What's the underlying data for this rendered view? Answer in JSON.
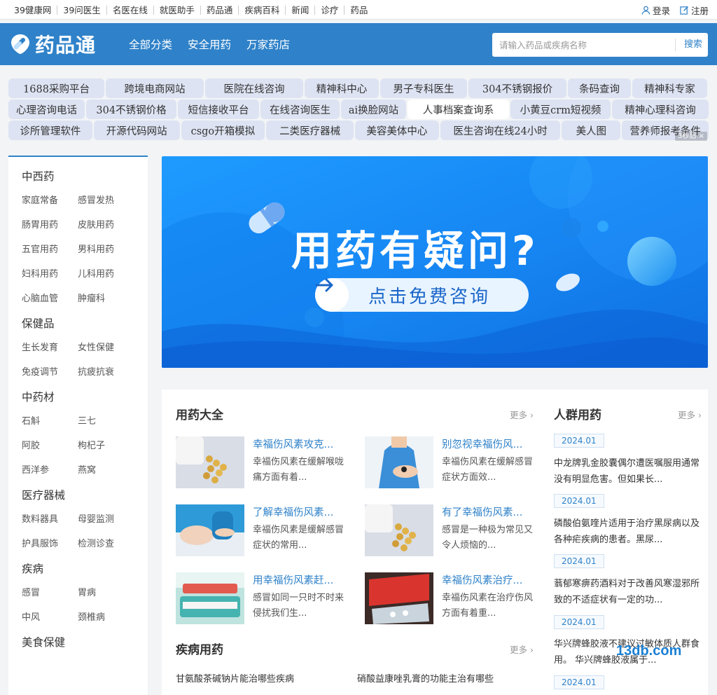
{
  "topbar": {
    "links": [
      "39健康网",
      "39问医生",
      "名医在线",
      "就医助手",
      "药品通",
      "疾病百科",
      "新闻",
      "诊疗",
      "药品"
    ],
    "login": "登录",
    "register": "注册"
  },
  "header": {
    "logo_text": "药品通",
    "nav": [
      "全部分类",
      "安全用药",
      "万家药店"
    ],
    "search_placeholder": "请输入药品或疾病名称",
    "search_button": "搜索"
  },
  "tags": {
    "rows": [
      [
        "1688采购平台",
        "跨境电商网站",
        "医院在线咨询",
        "精神科中心",
        "男子专科医生",
        "304不锈钢报价",
        "条码查询",
        "精神科专家"
      ],
      [
        "心理咨询电话",
        "304不锈钢价格",
        "短信接收平台",
        "在线咨询医生",
        "ai换脸网站",
        "人事档案查询系",
        "小黄豆crm短视频",
        "精神心理科咨询"
      ],
      [
        "诊所管理软件",
        "开源代码网站",
        "csgo开箱模拟",
        "二类医疗器械",
        "美容美体中心",
        "医生咨询在线24小时",
        "美人图",
        "营养师报考条件"
      ]
    ],
    "ad_badge": "3秒后 ×"
  },
  "sidebar": {
    "categories": [
      {
        "title": "中西药",
        "items": [
          "家庭常备",
          "感冒发热",
          "肠胃用药",
          "皮肤用药",
          "五官用药",
          "男科用药",
          "妇科用药",
          "儿科用药",
          "心脑血管",
          "肿瘤科"
        ]
      },
      {
        "title": "保健品",
        "items": [
          "生长发育",
          "女性保健",
          "免疫调节",
          "抗疲抗衰"
        ]
      },
      {
        "title": "中药材",
        "items": [
          "石斛",
          "三七",
          "阿胶",
          "枸杞子",
          "西洋参",
          "燕窝"
        ]
      },
      {
        "title": "医疗器械",
        "items": [
          "数料器具",
          "母婴监测",
          "护具服饰",
          "检测诊查"
        ]
      },
      {
        "title": "疾病",
        "items": [
          "感冒",
          "胃病",
          "中风",
          "颈椎病"
        ]
      },
      {
        "title": "美食保健",
        "items": []
      }
    ]
  },
  "banner": {
    "headline": "用药有疑问?",
    "cta": "点击免费咨询"
  },
  "drugs": {
    "title": "用药大全",
    "more": "更多 ›",
    "cards": [
      {
        "title": "幸福伤风素攻克...",
        "desc": "幸福伤风素在缓解喉咙痛方面有着..."
      },
      {
        "title": "别忽视幸福伤风...",
        "desc": "幸福伤风素在缓解感冒症状方面效..."
      },
      {
        "title": "了解幸福伤风素...",
        "desc": "幸福伤风素是缓解感冒症状的常用..."
      },
      {
        "title": "有了幸福伤风素...",
        "desc": "感冒是一种极为常见又令人烦恼的..."
      },
      {
        "title": "用幸福伤风素赶...",
        "desc": "感冒如同一只时不时来侵扰我们生..."
      },
      {
        "title": "幸福伤风素治疗...",
        "desc": "幸福伤风素在治疗伤风方面有着重..."
      }
    ]
  },
  "disease": {
    "title": "疾病用药",
    "more": "更多 ›",
    "items": [
      "甘氨酸茶碱钠片能治哪些疾病",
      "硝酸益康唑乳膏的功能主治有哪些"
    ]
  },
  "crowd": {
    "title": "人群用药",
    "more": "更多 ›",
    "items": [
      {
        "date": "2024.01",
        "text": "中龙牌乳金胶囊偶尔遭医嘱服用通常没有明显危害。但如果长..."
      },
      {
        "date": "2024.01",
        "text": "磷酸伯氨喹片适用于治疗黑尿病以及各种疟疾病的患者。黑尿..."
      },
      {
        "date": "2024.01",
        "text": "蓊郁寒痹药酒料对于改善风寒湿邪所致的不适症状有一定的功..."
      },
      {
        "date": "2024.01",
        "text": "华兴牌蜂胶液不建议过敏体质人群食用。 华兴牌蜂胶液属于..."
      },
      {
        "date": "2024.01",
        "text": ""
      }
    ]
  },
  "watermark": "13db.com",
  "colors": {
    "brand": "#2f82c9",
    "tag_bg": "#dde3f2",
    "page_bg": "#f2f4f6"
  }
}
